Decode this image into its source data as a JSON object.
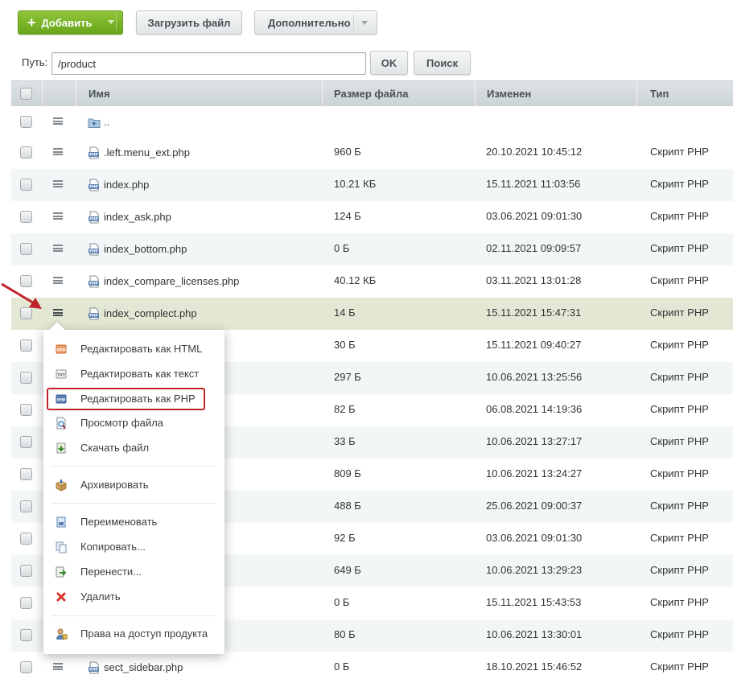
{
  "toolbar": {
    "add_label": "Добавить",
    "upload_label": "Загрузить файл",
    "more_label": "Дополнительно"
  },
  "path": {
    "label": "Путь:",
    "value": "/product",
    "ok_label": "OK",
    "search_label": "Поиск"
  },
  "table": {
    "columns": {
      "name": "Имя",
      "size": "Размер файла",
      "modified": "Изменен",
      "type": "Тип"
    },
    "up_label": "..",
    "rows": [
      {
        "name": ".left.menu_ext.php",
        "size": "960 Б",
        "modified": "20.10.2021 10:45:12",
        "type": "Скрипт PHP"
      },
      {
        "name": "index.php",
        "size": "10.21 КБ",
        "modified": "15.11.2021 11:03:56",
        "type": "Скрипт PHP"
      },
      {
        "name": "index_ask.php",
        "size": "124 Б",
        "modified": "03.06.2021 09:01:30",
        "type": "Скрипт PHP"
      },
      {
        "name": "index_bottom.php",
        "size": "0 Б",
        "modified": "02.11.2021 09:09:57",
        "type": "Скрипт PHP"
      },
      {
        "name": "index_compare_licenses.php",
        "size": "40.12 КБ",
        "modified": "03.11.2021 13:01:28",
        "type": "Скрипт PHP"
      },
      {
        "name": "index_complect.php",
        "size": "14 Б",
        "modified": "15.11.2021 15:47:31",
        "type": "Скрипт PHP"
      },
      {
        "name": "",
        "size": "30 Б",
        "modified": "15.11.2021 09:40:27",
        "type": "Скрипт PHP"
      },
      {
        "name": "",
        "size": "297 Б",
        "modified": "10.06.2021 13:25:56",
        "type": "Скрипт PHP"
      },
      {
        "name": "",
        "size": "82 Б",
        "modified": "06.08.2021 14:19:36",
        "type": "Скрипт PHP"
      },
      {
        "name": "",
        "size": "33 Б",
        "modified": "10.06.2021 13:27:17",
        "type": "Скрипт PHP"
      },
      {
        "name": "",
        "size": "809 Б",
        "modified": "10.06.2021 13:24:27",
        "type": "Скрипт PHP"
      },
      {
        "name": "",
        "size": "488 Б",
        "modified": "25.06.2021 09:00:37",
        "type": "Скрипт PHP"
      },
      {
        "name": "",
        "size": "92 Б",
        "modified": "03.06.2021 09:01:30",
        "type": "Скрипт PHP"
      },
      {
        "name": "",
        "size": "649 Б",
        "modified": "10.06.2021 13:29:23",
        "type": "Скрипт PHP"
      },
      {
        "name": "",
        "size": "0 Б",
        "modified": "15.11.2021 15:43:53",
        "type": "Скрипт PHP"
      },
      {
        "name": "",
        "size": "80 Б",
        "modified": "10.06.2021 13:30:01",
        "type": "Скрипт PHP"
      },
      {
        "name": "sect_sidebar.php",
        "size": "0 Б",
        "modified": "18.10.2021 15:46:52",
        "type": "Скрипт PHP"
      }
    ]
  },
  "context_menu": {
    "items": [
      {
        "label": "Редактировать как HTML",
        "icon": "html-edit-icon"
      },
      {
        "label": "Редактировать как текст",
        "icon": "txt-edit-icon"
      },
      {
        "label": "Редактировать как PHP",
        "icon": "php-edit-icon"
      },
      {
        "label": "Просмотр файла",
        "icon": "view-file-icon"
      },
      {
        "label": "Скачать файл",
        "icon": "download-icon"
      },
      {
        "label": "Архивировать",
        "icon": "archive-icon"
      },
      {
        "label": "Переименовать",
        "icon": "rename-icon"
      },
      {
        "label": "Копировать...",
        "icon": "copy-icon"
      },
      {
        "label": "Перенести...",
        "icon": "move-icon"
      },
      {
        "label": "Удалить",
        "icon": "delete-icon"
      },
      {
        "label": "Права на доступ продукта",
        "icon": "access-rights-icon"
      }
    ]
  },
  "colors": {
    "accent_green": "#7ab42a",
    "highlight_red": "#c0242a",
    "selected_row": "#e3e8d4"
  }
}
